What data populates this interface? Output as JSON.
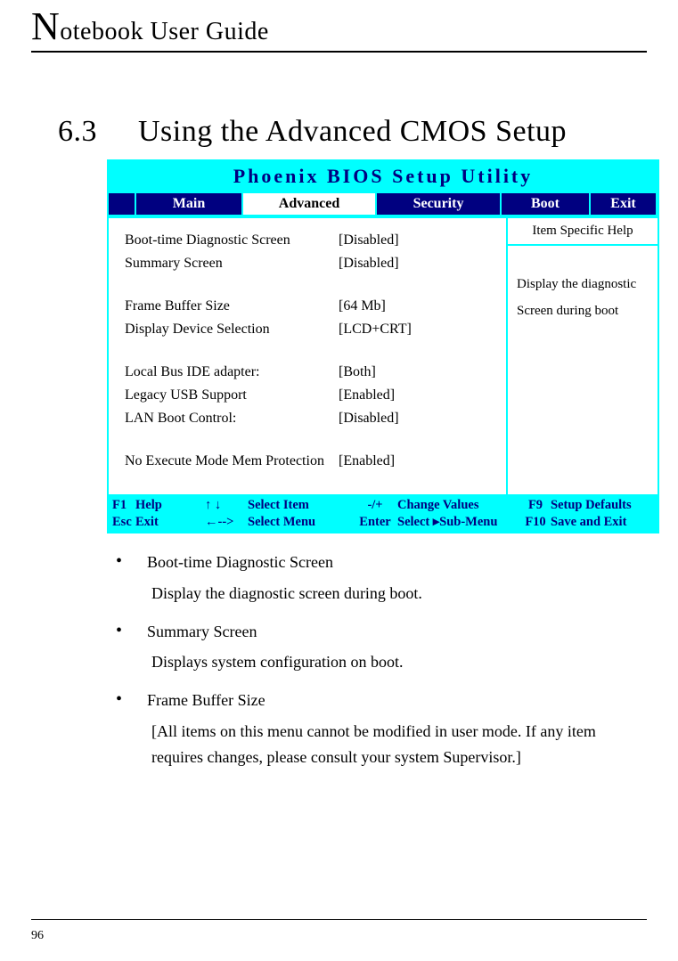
{
  "header": "otebook User Guide",
  "section_num": "6.3",
  "section_title": "Using the Advanced CMOS Setup",
  "bios": {
    "title": "Phoenix BIOS Setup Utility",
    "tabs": [
      "Main",
      "Advanced",
      "Security",
      "Boot",
      "Exit"
    ],
    "active_tab_index": 1,
    "help_header": "Item Specific Help",
    "help_body_line1": "Display the diagnostic",
    "help_body_line2": "Screen during boot",
    "rows": [
      {
        "label": "Boot-time Diagnostic Screen",
        "value": "[Disabled]"
      },
      {
        "label": "Summary Screen",
        "value": "[Disabled]"
      },
      {
        "label": "Frame Buffer Size",
        "value": " [64 Mb]"
      },
      {
        "label": "Display Device Selection",
        "value": "[LCD+CRT]"
      },
      {
        "label": "Local Bus IDE adapter:",
        "value": " [Both]"
      },
      {
        "label": "Legacy USB Support",
        "value": "[Enabled]"
      },
      {
        "label": "LAN Boot Control:",
        "value": "[Disabled]"
      },
      {
        "label": "No Execute Mode Mem Protection",
        "value": "[Enabled]"
      }
    ],
    "footer": {
      "r1c1": "F1",
      "r1c2": "Help",
      "r1c3": "↑ ↓",
      "r1c4": "Select Item",
      "r1c5": "-/+",
      "r1c6": "Change Values",
      "r1c7": "F9",
      "r1c8": "Setup Defaults",
      "r2c1": "Esc",
      "r2c2": "Exit",
      "r2c3": "←-->",
      "r2c4": "Select Menu",
      "r2c5": "Enter",
      "r2c6": "Select  ▸Sub-Menu",
      "r2c7": "F10",
      "r2c8": "Save and Exit"
    }
  },
  "bullets": [
    {
      "title": "Boot-time Diagnostic Screen",
      "desc": "Display the diagnostic screen during boot."
    },
    {
      "title": "Summary Screen",
      "desc": "Displays system configuration on boot."
    },
    {
      "title": "Frame Buffer Size",
      "desc": "[All items on this menu cannot be modified in user mode. If any item requires changes, please consult your system Supervisor.]"
    }
  ],
  "page_number": "96"
}
